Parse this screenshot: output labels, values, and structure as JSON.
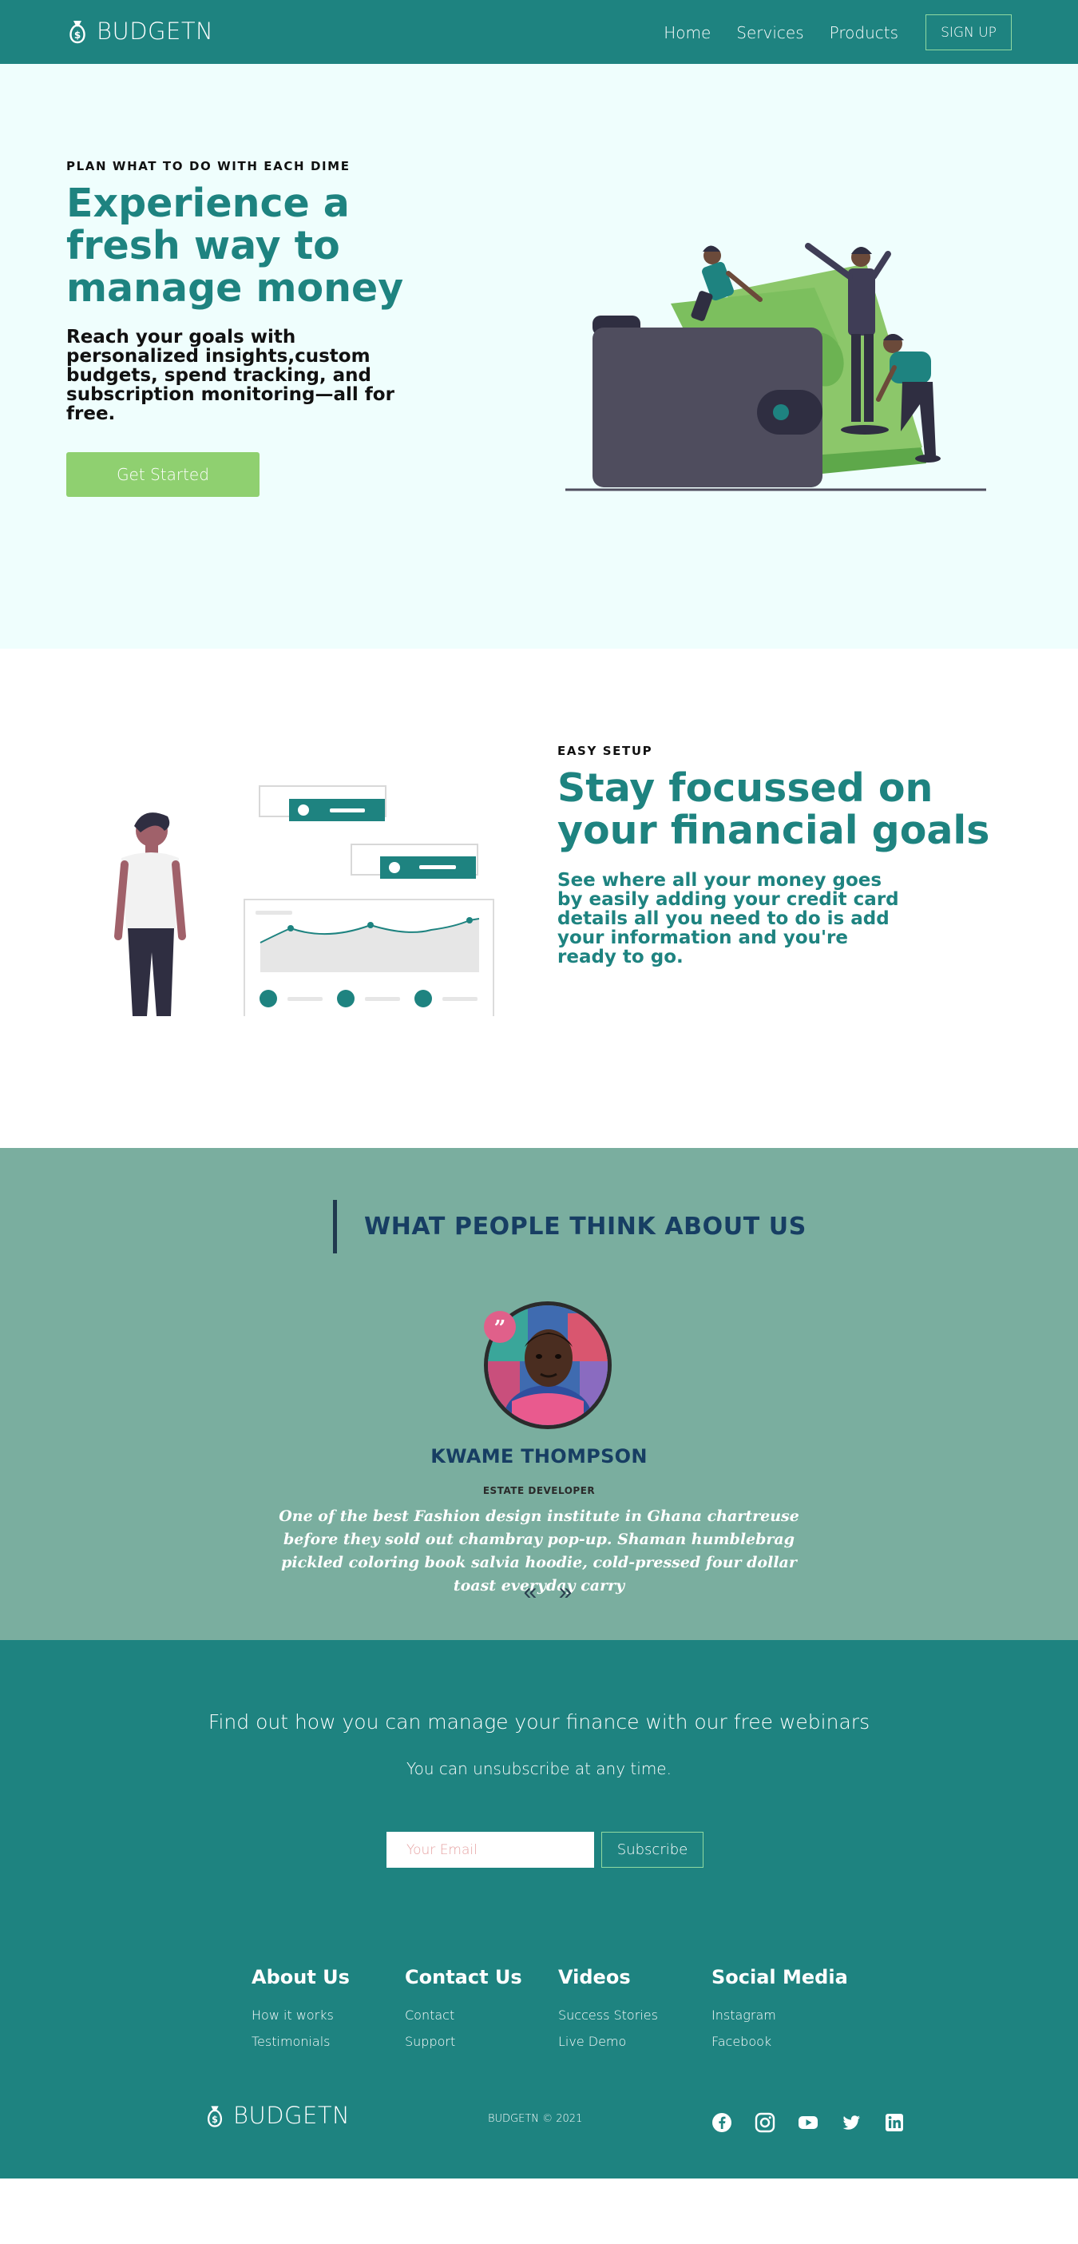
{
  "nav": {
    "brand": "BUDGETN",
    "links": [
      "Home",
      "Services",
      "Products"
    ],
    "signup_label": "SIGN UP"
  },
  "hero": {
    "eyebrow": "PLAN WHAT TO DO WITH EACH DIME",
    "title": "Experience a fresh way to manage money",
    "subtitle": "Reach your goals with personalized insights,custom budgets, spend tracking, and subscription monitoring—all for free.",
    "cta_label": "Get Started"
  },
  "setup": {
    "eyebrow": "EASY SETUP",
    "title": "Stay focussed on your financial goals",
    "subtitle": "See where all your money goes by easily adding your credit card details all you need to do is add your information and you're ready to go."
  },
  "testimonials": {
    "heading": "WHAT PEOPLE THINK ABOUT US",
    "quote_mark": "”",
    "name": "KWAME THOMPSON",
    "role": "ESTATE DEVELOPER",
    "quote": "One of the best Fashion design institute in Ghana chartreuse before they sold out chambray pop-up. Shaman humblebrag pickled coloring book salvia hoodie, cold-pressed four dollar toast everyday carry",
    "prev_label": "«",
    "next_label": "»"
  },
  "newsletter": {
    "title": "Find out how you can manage your finance with our free webinars",
    "subtitle": "You can unsubscribe at any time.",
    "email_placeholder": "Your Email",
    "subscribe_label": "Subscribe"
  },
  "footer": {
    "columns": [
      {
        "title": "About Us",
        "links": [
          "How it works",
          "Testimonials"
        ]
      },
      {
        "title": "Contact Us",
        "links": [
          "Contact",
          "Support"
        ]
      },
      {
        "title": "Videos",
        "links": [
          "Success Stories",
          "Live Demo"
        ]
      },
      {
        "title": "Social Media",
        "links": [
          "Instagram",
          "Facebook"
        ]
      }
    ],
    "brand": "BUDGETN",
    "copyright": "BUDGETN © 2021",
    "social_icons": [
      "facebook-icon",
      "instagram-icon",
      "youtube-icon",
      "twitter-icon",
      "linkedin-icon"
    ]
  },
  "colors": {
    "primary": "#1e8380",
    "hero_bg": "#effefd",
    "cta_green": "#8fd070",
    "testimonial_bg": "#7aae9f",
    "heading_navy": "#173e63"
  }
}
